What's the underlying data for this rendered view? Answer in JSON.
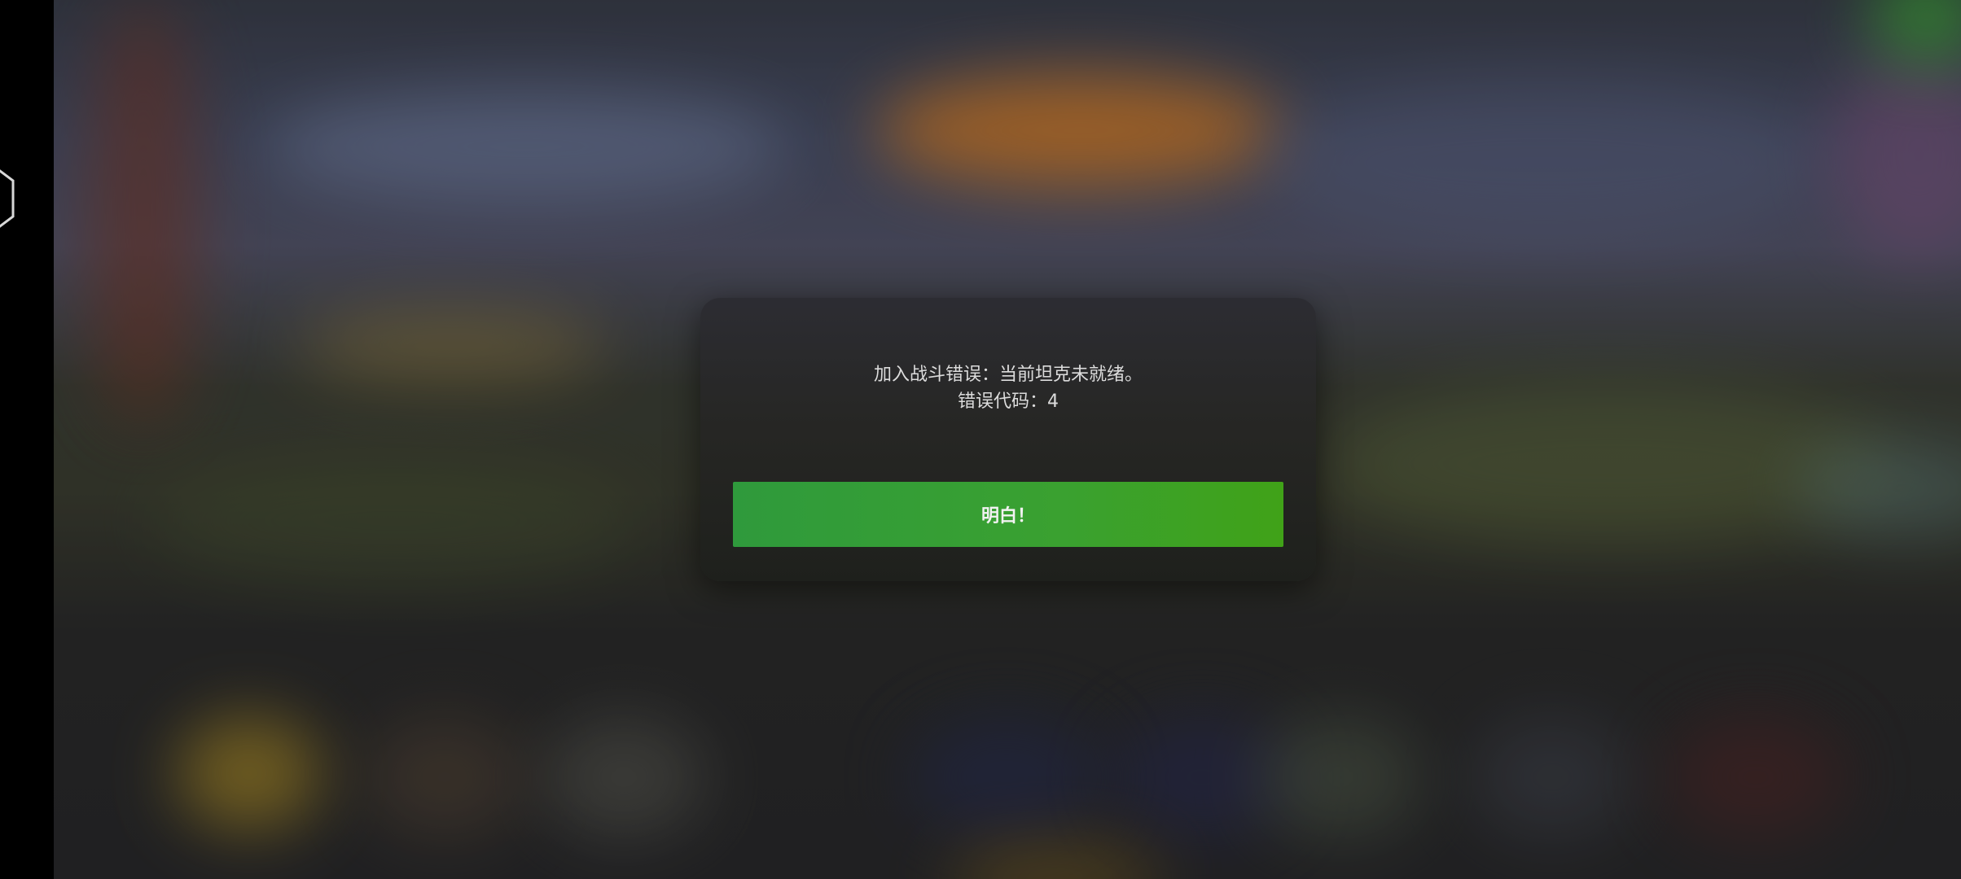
{
  "dialog": {
    "message_line1": "加入战斗错误：当前坦克未就绪。",
    "message_line2": "错误代码：4",
    "confirm_label": "明白！"
  },
  "colors": {
    "button_green": "#3aa130",
    "dialog_bg": "#2a2a2c",
    "text": "#dcdcdc"
  }
}
